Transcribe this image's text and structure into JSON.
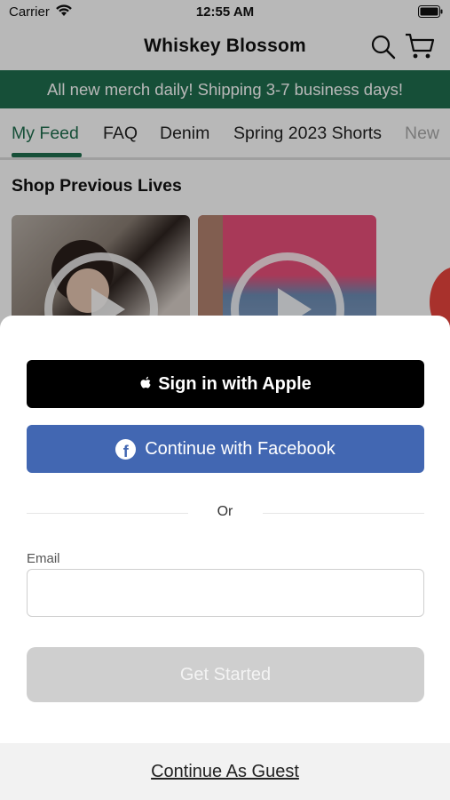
{
  "status_bar": {
    "carrier": "Carrier",
    "time": "12:55 AM"
  },
  "nav": {
    "title": "Whiskey Blossom",
    "search_icon": "search-icon",
    "cart_icon": "cart-icon"
  },
  "promo_banner": "All new merch daily! Shipping 3-7 business days!",
  "tabs": [
    "My Feed",
    "FAQ",
    "Denim",
    "Spring 2023 Shorts",
    "New"
  ],
  "active_tab": "My Feed",
  "section": {
    "title": "Shop Previous Lives"
  },
  "login_sheet": {
    "apple_button": "Sign in with Apple",
    "facebook_button": "Continue with Facebook",
    "divider_text": "Or",
    "email_label": "Email",
    "email_value": "",
    "get_started_button": "Get Started",
    "guest_link": "Continue As Guest"
  },
  "colors": {
    "brand_green": "#1f6e4e",
    "facebook_blue": "#4267b2",
    "apple_black": "#000000"
  }
}
